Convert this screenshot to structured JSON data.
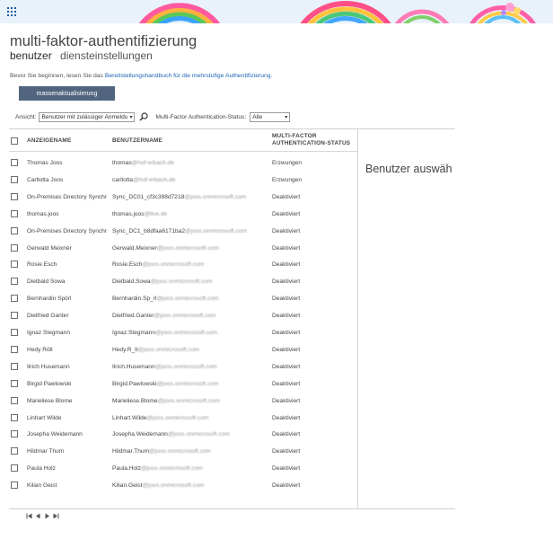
{
  "app": {
    "title": "multi-faktor-authentifizierung",
    "tabs": [
      {
        "label": "benutzer",
        "active": true
      },
      {
        "label": "diensteinstellungen",
        "active": false
      }
    ]
  },
  "intro": {
    "prefix": "Bevor Sie beginnen, lesen Sie das ",
    "link": "Bereitstellungshandbuch für die mehrstufige Authentifizierung",
    "suffix": "."
  },
  "bulk_button": "massenaktualisierung",
  "filters": {
    "view_label": "Ansicht:",
    "view_value": "Benutzer mit zulässiger Anmeldu",
    "status_label": "Multi-Factor Authentication-Status:",
    "status_value": "Alle"
  },
  "table": {
    "headers": {
      "display_name": "ANZEIGENAME",
      "user_name": "BENUTZERNAME",
      "mfa_status_line1": "MULTI-FACTOR",
      "mfa_status_line2": "AUTHENTICATION-STATUS"
    },
    "rows": [
      {
        "name": "Thomas Joos",
        "user": "thomas@hof-erbach.de",
        "status": "Erzwungen"
      },
      {
        "name": "Carllotta Joos",
        "user": "carllotta@hof-erbach.de",
        "status": "Erzwungen"
      },
      {
        "name": "On-Premises Directory Synchr",
        "user": "Sync_DC01_cf3c398d7218@joos.onmicrosoft.com",
        "status": "Deaktiviert"
      },
      {
        "name": "thomas.joos",
        "user": "thomas.joos@live.de",
        "status": "Deaktiviert"
      },
      {
        "name": "On-Premises Directory Synchr",
        "user": "Sync_DC1_b8dfaa6171ba2@joos.onmicrosoft.com",
        "status": "Deaktiviert"
      },
      {
        "name": "Gerwald Meixner",
        "user": "Gerwald.Meixner@joos.onmicrosoft.com",
        "status": "Deaktiviert"
      },
      {
        "name": "Rosie Esch",
        "user": "Rosie.Esch@joos.onmicrosoft.com",
        "status": "Deaktiviert"
      },
      {
        "name": "Dietbald Sowa",
        "user": "Dietbald.Sowa@joos.onmicrosoft.com",
        "status": "Deaktiviert"
      },
      {
        "name": "Bernhardin Spörl",
        "user": "Bernhardin.Sp_rl@joos.onmicrosoft.com",
        "status": "Deaktiviert"
      },
      {
        "name": "Dietfried Ganter",
        "user": "Dietfried.Ganter@joos.onmicrosoft.com",
        "status": "Deaktiviert"
      },
      {
        "name": "Ignaz Stegmann",
        "user": "Ignaz.Stegmann@joos.onmicrosoft.com",
        "status": "Deaktiviert"
      },
      {
        "name": "Hedy Röll",
        "user": "Hedy.R_ll@joos.onmicrosoft.com",
        "status": "Deaktiviert"
      },
      {
        "name": "Ilrich Husemann",
        "user": "Ilrich.Husemann@joos.onmicrosoft.com",
        "status": "Deaktiviert"
      },
      {
        "name": "Birgid Pawlowski",
        "user": "Birgid.Pawlowski@joos.onmicrosoft.com",
        "status": "Deaktiviert"
      },
      {
        "name": "Marieliese Blome",
        "user": "Marieliese.Blome@joos.onmicrosoft.com",
        "status": "Deaktiviert"
      },
      {
        "name": "Linhart Wilde",
        "user": "Linhart.Wilde@joos.onmicrosoft.com",
        "status": "Deaktiviert"
      },
      {
        "name": "Josepha Weidemann",
        "user": "Josepha.Weidemann@joos.onmicrosoft.com",
        "status": "Deaktiviert"
      },
      {
        "name": "Hildmar Thum",
        "user": "Hildmar.Thum@joos.onmicrosoft.com",
        "status": "Deaktiviert"
      },
      {
        "name": "Paula Holz",
        "user": "Paula.Holz@joos.onmicrosoft.com",
        "status": "Deaktiviert"
      },
      {
        "name": "Kilian Geist",
        "user": "Kilian.Geist@joos.onmicrosoft.com",
        "status": "Deaktiviert"
      }
    ]
  },
  "side_panel": {
    "text": "Benutzer auswäh"
  },
  "icons": {
    "app_launcher": "waffle-icon",
    "search": "search-icon",
    "pager": [
      "first-page-icon",
      "previous-page-icon",
      "next-page-icon",
      "last-page-icon"
    ]
  },
  "colors": {
    "accent_button": "#51667e",
    "link": "#1c64b4",
    "banner_bg": "#e9f1fb"
  }
}
